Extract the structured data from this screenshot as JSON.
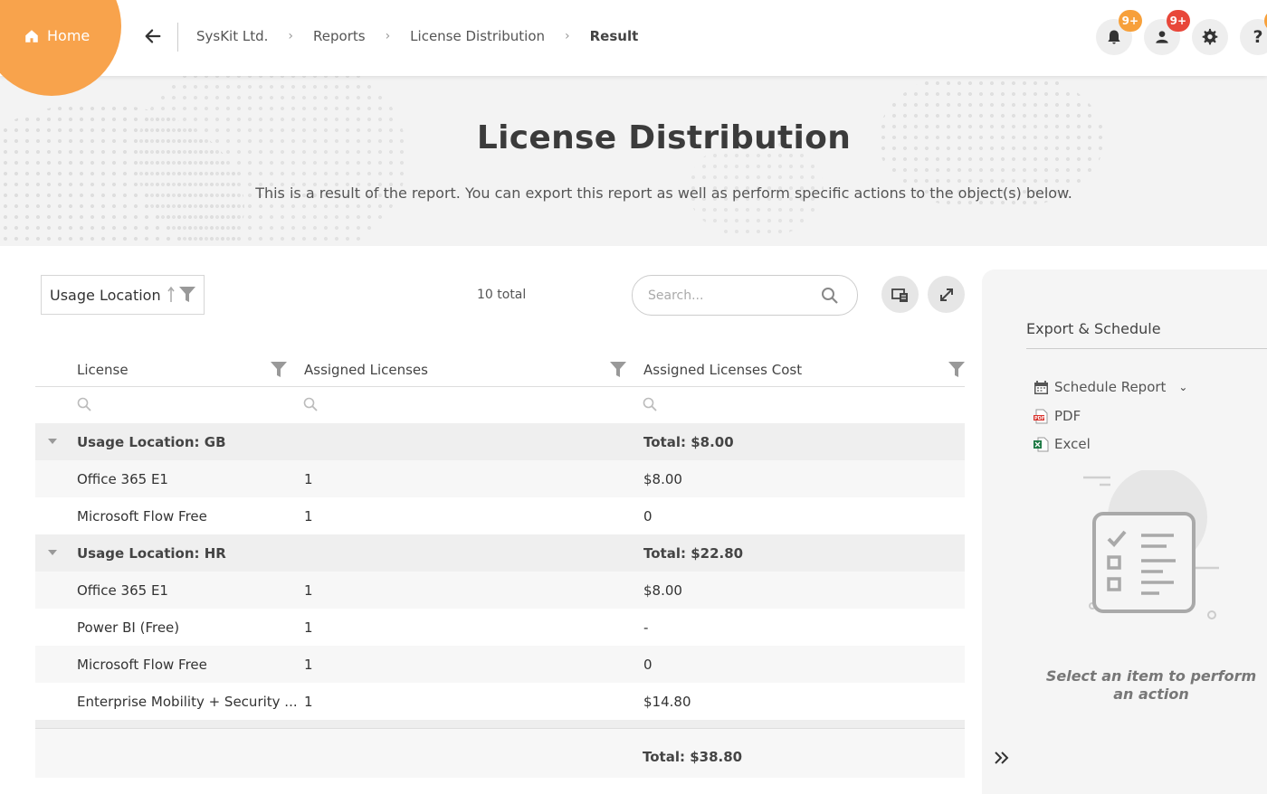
{
  "nav": {
    "home_label": "Home",
    "breadcrumbs": [
      "SysKit Ltd.",
      "Reports",
      "License Distribution"
    ],
    "current": "Result",
    "badges": {
      "notifications": "9+",
      "users": "9+",
      "help": "!"
    }
  },
  "hero": {
    "title": "License Distribution",
    "subtitle": "This is a result of the report. You can export this report as well as perform specific actions to the object(s) below."
  },
  "toolbar": {
    "group_by": "Usage Location",
    "total": "10 total",
    "search_placeholder": "Search..."
  },
  "grid": {
    "columns": [
      "License",
      "Assigned Licenses",
      "Assigned Licenses Cost"
    ],
    "groups": [
      {
        "label": "Usage Location: GB",
        "total": "Total: $8.00",
        "rows": [
          {
            "license": "Office 365 E1",
            "assigned": "1",
            "cost": "$8.00"
          },
          {
            "license": "Microsoft Flow Free",
            "assigned": "1",
            "cost": "0"
          }
        ]
      },
      {
        "label": "Usage Location: HR",
        "total": "Total: $22.80",
        "rows": [
          {
            "license": "Office 365 E1",
            "assigned": "1",
            "cost": "$8.00"
          },
          {
            "license": "Power BI (Free)",
            "assigned": "1",
            "cost": "-"
          },
          {
            "license": "Microsoft Flow Free",
            "assigned": "1",
            "cost": "0"
          },
          {
            "license": "Enterprise Mobility + Security ...",
            "assigned": "1",
            "cost": "$14.80"
          }
        ]
      }
    ],
    "grand_total": "Total: $38.80"
  },
  "panel": {
    "title": "Export & Schedule",
    "schedule_label": "Schedule Report",
    "pdf_label": "PDF",
    "excel_label": "Excel",
    "hint": "Select an item to perform an action"
  },
  "colors": {
    "accent": "#f8a34c",
    "badge_red": "#e8473a",
    "badge_orange": "#f7a03a"
  }
}
